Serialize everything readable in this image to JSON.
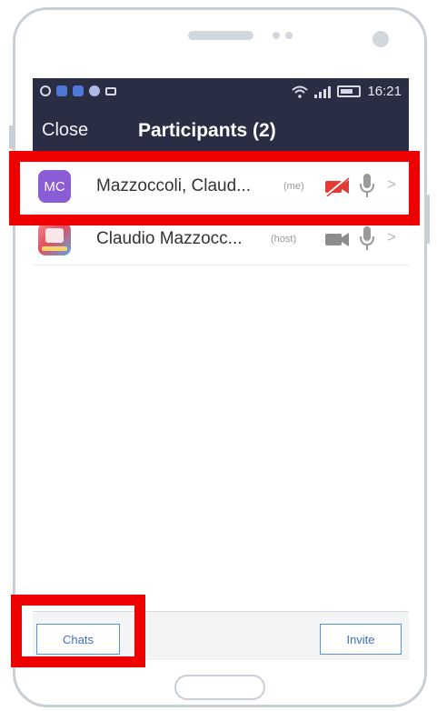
{
  "status_bar": {
    "time": "16:21"
  },
  "header": {
    "close_label": "Close",
    "title": "Participants (2)"
  },
  "participants": [
    {
      "initials": "MC",
      "name": "Mazzoccoli, Claud...",
      "role": "(me)",
      "video": "video-off-icon",
      "audio": "mic-icon"
    },
    {
      "initials": "",
      "name": "Claudio Mazzocc...",
      "role": "(host)",
      "video": "video-icon",
      "audio": "mic-icon"
    }
  ],
  "footer": {
    "chats_label": "Chats",
    "invite_label": "Invite"
  },
  "colors": {
    "header_bg": "#2a2e44",
    "avatar_me": "#8a5cd6",
    "video_off": "#e53935",
    "button_accent": "#3f6fc4",
    "annotation": "#ee0000"
  }
}
